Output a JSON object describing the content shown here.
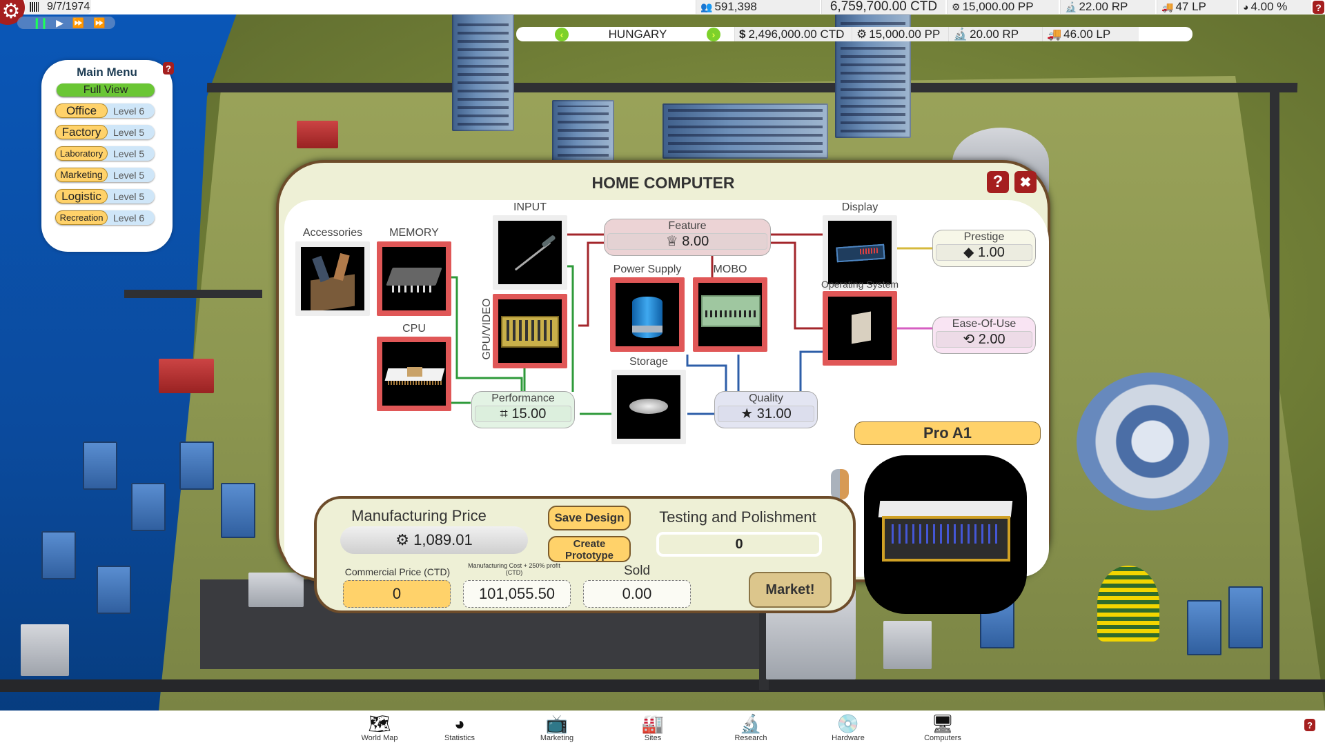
{
  "topbar": {
    "date": "9/7/1974",
    "population": "591,398",
    "money": "6,759,700.00 CTD",
    "pp": "15,000.00 PP",
    "rp": "22.00 RP",
    "lp": "47 LP",
    "share": "4.00 %",
    "icons": {
      "settings": "gear-icon",
      "calendar": "calendar-icon",
      "pause": "pause-icon",
      "play": "play-icon",
      "fast": "fast-forward-icon",
      "faster": "fastest-forward-icon"
    }
  },
  "country_bar": {
    "country": "HUNGARY",
    "money": "2,496,000.00 CTD",
    "pp": "15,000.00 PP",
    "rp": "20.00 RP",
    "lp": "46.00 LP"
  },
  "main_menu": {
    "title": "Main Menu",
    "full_view": "Full View",
    "items": [
      {
        "name": "Office",
        "level": "Level 6"
      },
      {
        "name": "Factory",
        "level": "Level 5"
      },
      {
        "name": "Laboratory",
        "level": "Level 5"
      },
      {
        "name": "Marketing",
        "level": "Level 5"
      },
      {
        "name": "Logistic",
        "level": "Level 5"
      },
      {
        "name": "Recreation",
        "level": "Level 6"
      }
    ]
  },
  "dialog": {
    "title": "HOME COMPUTER",
    "help": "?",
    "close": "✖",
    "parts": {
      "accessories": "Accessories",
      "memory": "MEMORY",
      "cpu": "CPU",
      "input": "INPUT",
      "gpu": "GPU/VIDEO",
      "power_supply": "Power Supply",
      "mobo": "MOBO",
      "storage": "Storage",
      "display": "Display",
      "os": "Operating System"
    },
    "metrics": {
      "feature": {
        "label": "Feature",
        "value": "8.00"
      },
      "performance": {
        "label": "Performance",
        "value": "15.00"
      },
      "quality": {
        "label": "Quality",
        "value": "31.00"
      },
      "prestige": {
        "label": "Prestige",
        "value": "1.00"
      },
      "ease": {
        "label": "Ease-Of-Use",
        "value": "2.00"
      }
    },
    "model_name": "Pro A1",
    "bottom": {
      "mfg_price_label": "Manufacturing Price",
      "mfg_price": "1,089.01",
      "save_design": "Save Design",
      "create_prototype": "Create Prototype",
      "testing_label": "Testing and Polishment",
      "testing_value": "0",
      "commercial_label": "Commercial Price (CTD)",
      "commercial_value": "0",
      "cost_profit_label": "Manufacturing Cost + 250% profit (CTD)",
      "cost_profit_value": "101,055.50",
      "sold_label": "Sold",
      "sold_value": "0.00",
      "market": "Market!"
    }
  },
  "nav": [
    {
      "label": "World Map",
      "icon": "🗺"
    },
    {
      "label": "Statistics",
      "icon": "◕"
    },
    {
      "label": "Marketing",
      "icon": "📺"
    },
    {
      "label": "Sites",
      "icon": "🏭"
    },
    {
      "label": "Research",
      "icon": "🔬"
    },
    {
      "label": "Hardware",
      "icon": "💿"
    },
    {
      "label": "Computers",
      "icon": "🖥"
    }
  ],
  "colors": {
    "accent_red": "#a51f1f",
    "accent_yellow": "#ffd26a",
    "perf_green": "#2e9a3a",
    "quality_blue": "#2d5ea8",
    "feature_red": "#a3262b"
  }
}
